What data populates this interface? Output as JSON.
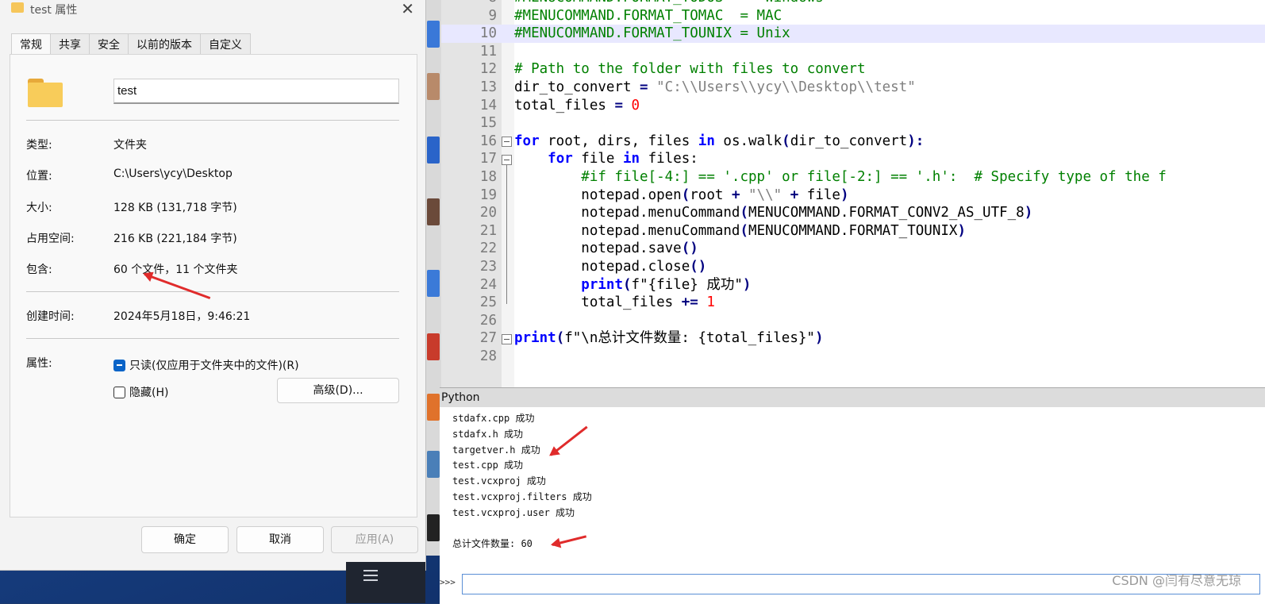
{
  "dialog": {
    "title": "test 属性",
    "tabs": [
      "常规",
      "共享",
      "安全",
      "以前的版本",
      "自定义"
    ],
    "folder_name": "test",
    "rows": [
      {
        "label": "类型:",
        "value": "文件夹"
      },
      {
        "label": "位置:",
        "value": "C:\\Users\\ycy\\Desktop"
      },
      {
        "label": "大小:",
        "value": "128 KB (131,718 字节)"
      },
      {
        "label": "占用空间:",
        "value": "216 KB (221,184 字节)"
      },
      {
        "label": "包含:",
        "value": "60 个文件，11 个文件夹"
      },
      {
        "label": "创建时间:",
        "value": "2024年5月18日，9:46:21"
      }
    ],
    "attributes_label": "属性:",
    "readonly_label": "只读(仅应用于文件夹中的文件)(R)",
    "hidden_label": "隐藏(H)",
    "advanced_label": "高级(D)...",
    "ok_label": "确定",
    "cancel_label": "取消",
    "apply_label": "应用(A)"
  },
  "editor": {
    "lines": [
      {
        "n": "9",
        "html": "<span class='cm'>#MENUCOMMAND.FORMAT_TOMAC  = MAC</span>"
      },
      {
        "n": "10",
        "html": "<span class='cm'>#MENUCOMMAND.FORMAT_TOUNIX = Unix</span>",
        "hl": true
      },
      {
        "n": "11",
        "html": ""
      },
      {
        "n": "12",
        "html": "<span class='cm'># Path to the folder with files to convert</span>"
      },
      {
        "n": "13",
        "html": "<span class='tx'>dir_to_convert </span><span class='op'>=</span><span class='str'> \"C:\\\\Users\\\\ycy\\\\Desktop\\\\test\"</span>"
      },
      {
        "n": "14",
        "html": "<span class='tx'>total_files </span><span class='op'>=</span><span class='num'> 0</span>"
      },
      {
        "n": "15",
        "html": ""
      },
      {
        "n": "16",
        "html": "<span class='kw'>for</span><span class='tx'> root, dirs, files </span><span class='kw'>in</span><span class='tx'> os.walk</span><span class='op'>(</span><span class='tx'>dir_to_convert</span><span class='op'>):</span>"
      },
      {
        "n": "17",
        "html": "<span class='tx'>    </span><span class='kw'>for</span><span class='tx'> file </span><span class='kw'>in</span><span class='tx'> files:</span>"
      },
      {
        "n": "18",
        "html": "<span class='cm'>        #if file[-4:] == '.cpp' or file[-2:] == '.h':  # Specify type of the f</span>"
      },
      {
        "n": "19",
        "html": "<span class='tx'>        notepad.open</span><span class='op'>(</span><span class='tx'>root </span><span class='op'>+</span><span class='str'> \"\\\\\" </span><span class='op'>+</span><span class='tx'> file</span><span class='op'>)</span>"
      },
      {
        "n": "20",
        "html": "<span class='tx'>        notepad.menuCommand</span><span class='op'>(</span><span class='tx'>MENUCOMMAND.FORMAT_CONV2_AS_UTF_8</span><span class='op'>)</span>"
      },
      {
        "n": "21",
        "html": "<span class='tx'>        notepad.menuCommand</span><span class='op'>(</span><span class='tx'>MENUCOMMAND.FORMAT_TOUNIX</span><span class='op'>)</span>"
      },
      {
        "n": "22",
        "html": "<span class='tx'>        notepad.save</span><span class='op'>()</span>"
      },
      {
        "n": "23",
        "html": "<span class='tx'>        notepad.close</span><span class='op'>()</span>"
      },
      {
        "n": "24",
        "html": "<span class='tx'>        </span><span class='kw'>print</span><span class='op'>(</span><span class='tx'>f\"{file} 成功\"</span><span class='op'>)</span>"
      },
      {
        "n": "25",
        "html": "<span class='tx'>        total_files </span><span class='op'>+=</span><span class='num'> 1</span>"
      },
      {
        "n": "26",
        "html": ""
      },
      {
        "n": "27",
        "html": "<span class='kw'>print</span><span class='op'>(</span><span class='tx'>f\"\\n总计文件数量: {total_files}\"</span><span class='op'>)</span>"
      },
      {
        "n": "28",
        "html": ""
      }
    ]
  },
  "console": {
    "title": "Python",
    "output": [
      "stdafx.cpp 成功",
      "stdafx.h 成功",
      "targetver.h 成功",
      "test.cpp 成功",
      "test.vcxproj 成功",
      "test.vcxproj.filters 成功",
      "test.vcxproj.user 成功",
      "",
      "总计文件数量: 60"
    ],
    "prompt": ">>>",
    "input_value": ""
  },
  "watermark": "CSDN @闫有尽意无琼",
  "colors": {
    "annotation_arrow": "#e02b2b",
    "accent": "#0a64c8"
  }
}
